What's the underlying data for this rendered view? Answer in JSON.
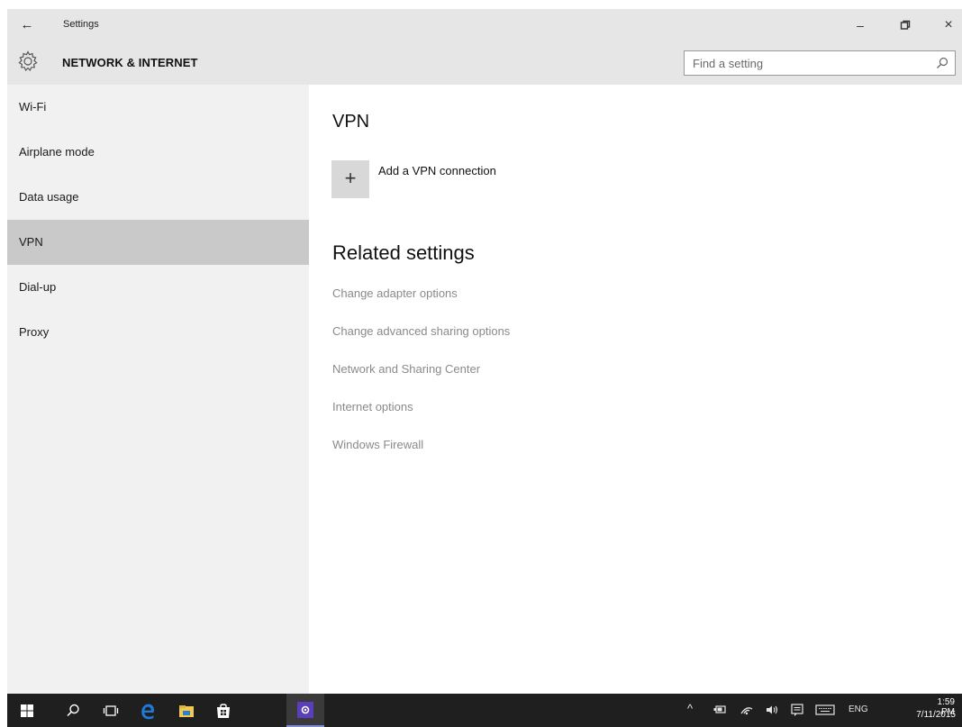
{
  "window": {
    "title": "Settings",
    "back_glyph": "←",
    "min_glyph": "–",
    "max_glyph": "◘",
    "close_glyph": "×"
  },
  "header": {
    "title": "NETWORK & INTERNET",
    "icon": "gear-icon"
  },
  "search": {
    "placeholder": "Find a setting",
    "value": ""
  },
  "sidebar": {
    "items": [
      {
        "label": "Wi-Fi"
      },
      {
        "label": "Airplane mode"
      },
      {
        "label": "Data usage"
      },
      {
        "label": "VPN",
        "selected": true
      },
      {
        "label": "Dial-up"
      },
      {
        "label": "Proxy"
      }
    ]
  },
  "main": {
    "title": "VPN",
    "add_glyph": "+",
    "add_label": "Add a VPN connection",
    "related_title": "Related settings",
    "related_links": [
      "Change adapter options",
      "Change advanced sharing options",
      "Network and Sharing Center",
      "Internet options",
      "Windows Firewall"
    ]
  },
  "taskbar": {
    "apps": [
      "windows-start-icon",
      "search-icon",
      "task-view-icon",
      "edge-icon",
      "file-explorer-icon",
      "store-icon",
      "settings-icon"
    ],
    "tray": {
      "chevron": "^",
      "language": "ENG"
    },
    "clock": {
      "time": "1:59 PM",
      "date": "7/11/2015"
    }
  },
  "colors": {
    "titlebar": "#e6e6e6",
    "sidebar": "#f1f1f1",
    "selected": "#c9c9c9",
    "link": "#8a8a8a",
    "taskbar": "#1f1f1f",
    "edge_blue": "#1e7ad9",
    "settings_purple": "#5a3fb8"
  }
}
